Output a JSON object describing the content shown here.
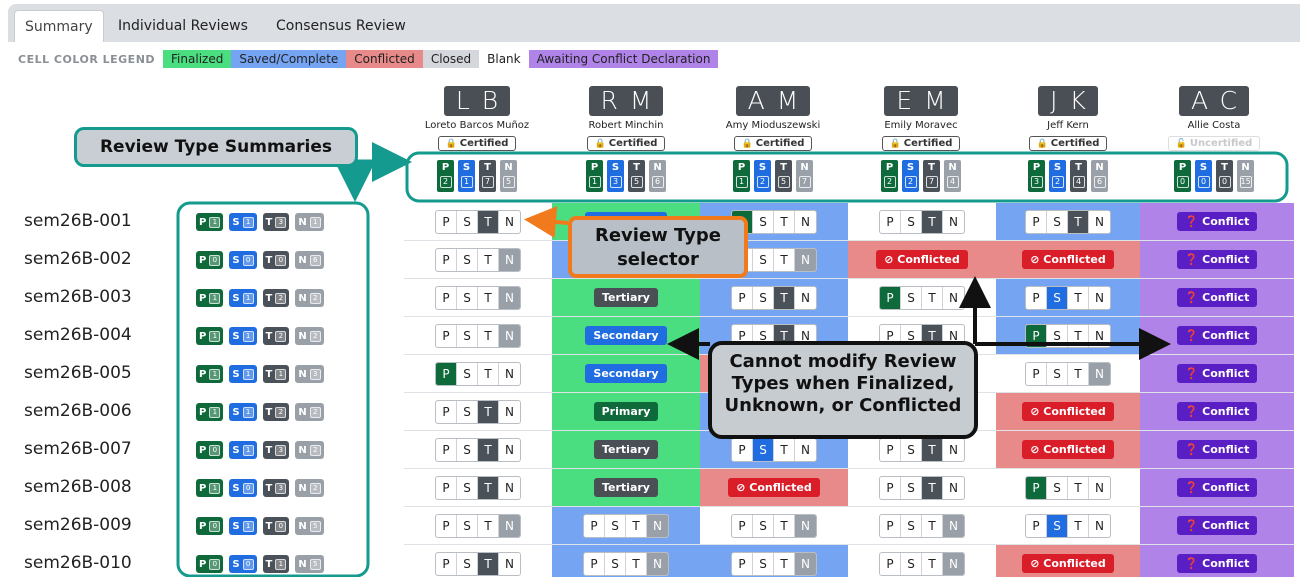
{
  "tabs": [
    {
      "label": "Summary",
      "active": true
    },
    {
      "label": "Individual Reviews",
      "active": false
    },
    {
      "label": "Consensus Review",
      "active": false
    }
  ],
  "legend": {
    "title": "CELL COLOR LEGEND",
    "items": [
      {
        "label": "Finalized",
        "color": "#4ade80"
      },
      {
        "label": "Saved/Complete",
        "color": "#74a4f2"
      },
      {
        "label": "Conflicted",
        "color": "#e88a8a"
      },
      {
        "label": "Closed",
        "color": "#d4d7dc"
      },
      {
        "label": "Blank",
        "color": "#ffffff"
      },
      {
        "label": "Awaiting Conflict Declaration",
        "color": "#b083e8"
      }
    ]
  },
  "reviewers": [
    {
      "initials": "LB",
      "name": "Loreto Barcos Muñoz",
      "status": "Certified",
      "counts": {
        "P": "2",
        "S": "1",
        "T": "7",
        "N": "5"
      }
    },
    {
      "initials": "RM",
      "name": "Robert Minchin",
      "status": "Certified",
      "counts": {
        "P": "1",
        "S": "3",
        "T": "5",
        "N": "6"
      }
    },
    {
      "initials": "AM",
      "name": "Amy Mioduszewski",
      "status": "Certified",
      "counts": {
        "P": "1",
        "S": "2",
        "T": "5",
        "N": "7"
      }
    },
    {
      "initials": "EM",
      "name": "Emily Moravec",
      "status": "Certified",
      "counts": {
        "P": "2",
        "S": "2",
        "T": "7",
        "N": "4"
      }
    },
    {
      "initials": "JK",
      "name": "Jeff Kern",
      "status": "Certified",
      "counts": {
        "P": "3",
        "S": "2",
        "T": "4",
        "N": "6"
      }
    },
    {
      "initials": "AC",
      "name": "Allie Costa",
      "status": "Uncertified",
      "counts": {
        "P": "0",
        "S": "0",
        "T": "0",
        "N": "15"
      }
    }
  ],
  "type_letters": [
    "P",
    "S",
    "T",
    "N"
  ],
  "pills": {
    "conflicted": "Conflicted",
    "conflict": "Conflict",
    "primary": "Primary",
    "secondary": "Secondary",
    "tertiary": "Tertiary"
  },
  "rows": [
    {
      "id": "sem26B-001",
      "counts": [
        "1",
        "1",
        "3",
        "1"
      ],
      "cells": [
        {
          "bg": "white",
          "kind": "seg",
          "active": "T"
        },
        {
          "bg": "green",
          "kind": "pill",
          "pill": "secondary"
        },
        {
          "bg": "blue",
          "kind": "seg",
          "active": "P"
        },
        {
          "bg": "white",
          "kind": "seg",
          "active": "T"
        },
        {
          "bg": "blue",
          "kind": "seg",
          "active": "T"
        },
        {
          "bg": "purple",
          "kind": "conflict"
        }
      ]
    },
    {
      "id": "sem26B-002",
      "counts": [
        "0",
        "0",
        "0",
        "6"
      ],
      "cells": [
        {
          "bg": "white",
          "kind": "seg",
          "active": "N"
        },
        {
          "bg": "blue",
          "kind": "seg",
          "active": "N"
        },
        {
          "bg": "blue",
          "kind": "seg",
          "active": "N"
        },
        {
          "bg": "red",
          "kind": "conflicted"
        },
        {
          "bg": "red",
          "kind": "conflicted"
        },
        {
          "bg": "purple",
          "kind": "conflict"
        }
      ]
    },
    {
      "id": "sem26B-003",
      "counts": [
        "1",
        "1",
        "2",
        "2"
      ],
      "cells": [
        {
          "bg": "white",
          "kind": "seg",
          "active": "N"
        },
        {
          "bg": "green",
          "kind": "pill",
          "pill": "tertiary"
        },
        {
          "bg": "blue",
          "kind": "seg",
          "active": "T"
        },
        {
          "bg": "white",
          "kind": "seg",
          "active": "P"
        },
        {
          "bg": "blue",
          "kind": "seg",
          "active": "S"
        },
        {
          "bg": "purple",
          "kind": "conflict"
        }
      ]
    },
    {
      "id": "sem26B-004",
      "counts": [
        "1",
        "1",
        "2",
        "2"
      ],
      "cells": [
        {
          "bg": "white",
          "kind": "seg",
          "active": "N"
        },
        {
          "bg": "green",
          "kind": "pill",
          "pill": "secondary"
        },
        {
          "bg": "blue",
          "kind": "seg",
          "active": "T"
        },
        {
          "bg": "white",
          "kind": "seg",
          "active": "T"
        },
        {
          "bg": "blue",
          "kind": "seg",
          "active": "P"
        },
        {
          "bg": "purple",
          "kind": "conflict"
        }
      ]
    },
    {
      "id": "sem26B-005",
      "counts": [
        "1",
        "1",
        "1",
        "3"
      ],
      "cells": [
        {
          "bg": "white",
          "kind": "seg",
          "active": "P"
        },
        {
          "bg": "green",
          "kind": "pill",
          "pill": "secondary"
        },
        {
          "bg": "red",
          "kind": "none"
        },
        {
          "bg": "white",
          "kind": "none"
        },
        {
          "bg": "white",
          "kind": "seg",
          "active": "N"
        },
        {
          "bg": "purple",
          "kind": "conflict"
        }
      ]
    },
    {
      "id": "sem26B-006",
      "counts": [
        "1",
        "1",
        "2",
        "2"
      ],
      "cells": [
        {
          "bg": "white",
          "kind": "seg",
          "active": "T"
        },
        {
          "bg": "green",
          "kind": "pill",
          "pill": "primary"
        },
        {
          "bg": "blue",
          "kind": "none"
        },
        {
          "bg": "white",
          "kind": "none"
        },
        {
          "bg": "red",
          "kind": "conflicted"
        },
        {
          "bg": "purple",
          "kind": "conflict"
        }
      ]
    },
    {
      "id": "sem26B-007",
      "counts": [
        "0",
        "1",
        "3",
        "2"
      ],
      "cells": [
        {
          "bg": "white",
          "kind": "seg",
          "active": "T"
        },
        {
          "bg": "green",
          "kind": "pill",
          "pill": "tertiary"
        },
        {
          "bg": "blue",
          "kind": "seg",
          "active": "S"
        },
        {
          "bg": "white",
          "kind": "seg",
          "active": "T"
        },
        {
          "bg": "red",
          "kind": "conflicted"
        },
        {
          "bg": "purple",
          "kind": "conflict"
        }
      ]
    },
    {
      "id": "sem26B-008",
      "counts": [
        "1",
        "0",
        "3",
        "2"
      ],
      "cells": [
        {
          "bg": "white",
          "kind": "seg",
          "active": "T"
        },
        {
          "bg": "green",
          "kind": "pill",
          "pill": "tertiary"
        },
        {
          "bg": "red",
          "kind": "conflicted"
        },
        {
          "bg": "white",
          "kind": "seg",
          "active": "T"
        },
        {
          "bg": "white",
          "kind": "seg",
          "active": "P"
        },
        {
          "bg": "purple",
          "kind": "conflict"
        }
      ]
    },
    {
      "id": "sem26B-009",
      "counts": [
        "0",
        "1",
        "0",
        "5"
      ],
      "cells": [
        {
          "bg": "white",
          "kind": "seg",
          "active": "N"
        },
        {
          "bg": "blue",
          "kind": "seg",
          "active": "N"
        },
        {
          "bg": "white",
          "kind": "seg",
          "active": "N"
        },
        {
          "bg": "white",
          "kind": "seg",
          "active": "N"
        },
        {
          "bg": "white",
          "kind": "seg",
          "active": "S"
        },
        {
          "bg": "purple",
          "kind": "conflict"
        }
      ]
    },
    {
      "id": "sem26B-010",
      "counts": [
        "0",
        "0",
        "1",
        "5"
      ],
      "cells": [
        {
          "bg": "white",
          "kind": "seg",
          "active": "T"
        },
        {
          "bg": "blue",
          "kind": "seg",
          "active": "N"
        },
        {
          "bg": "blue",
          "kind": "seg",
          "active": "N"
        },
        {
          "bg": "white",
          "kind": "seg",
          "active": "N"
        },
        {
          "bg": "red",
          "kind": "conflicted"
        },
        {
          "bg": "purple",
          "kind": "conflict"
        }
      ]
    }
  ],
  "cell_colors": {
    "white": "#ffffff",
    "green": "#4ade80",
    "blue": "#74a4f2",
    "red": "#e88a8a",
    "purple": "#b083e8"
  },
  "annotations": {
    "summaries": "Review Type Summaries",
    "selector": "Review Type selector",
    "cannot_modify": "Cannot modify Review Types when Finalized, Unknown, or Conflicted"
  }
}
